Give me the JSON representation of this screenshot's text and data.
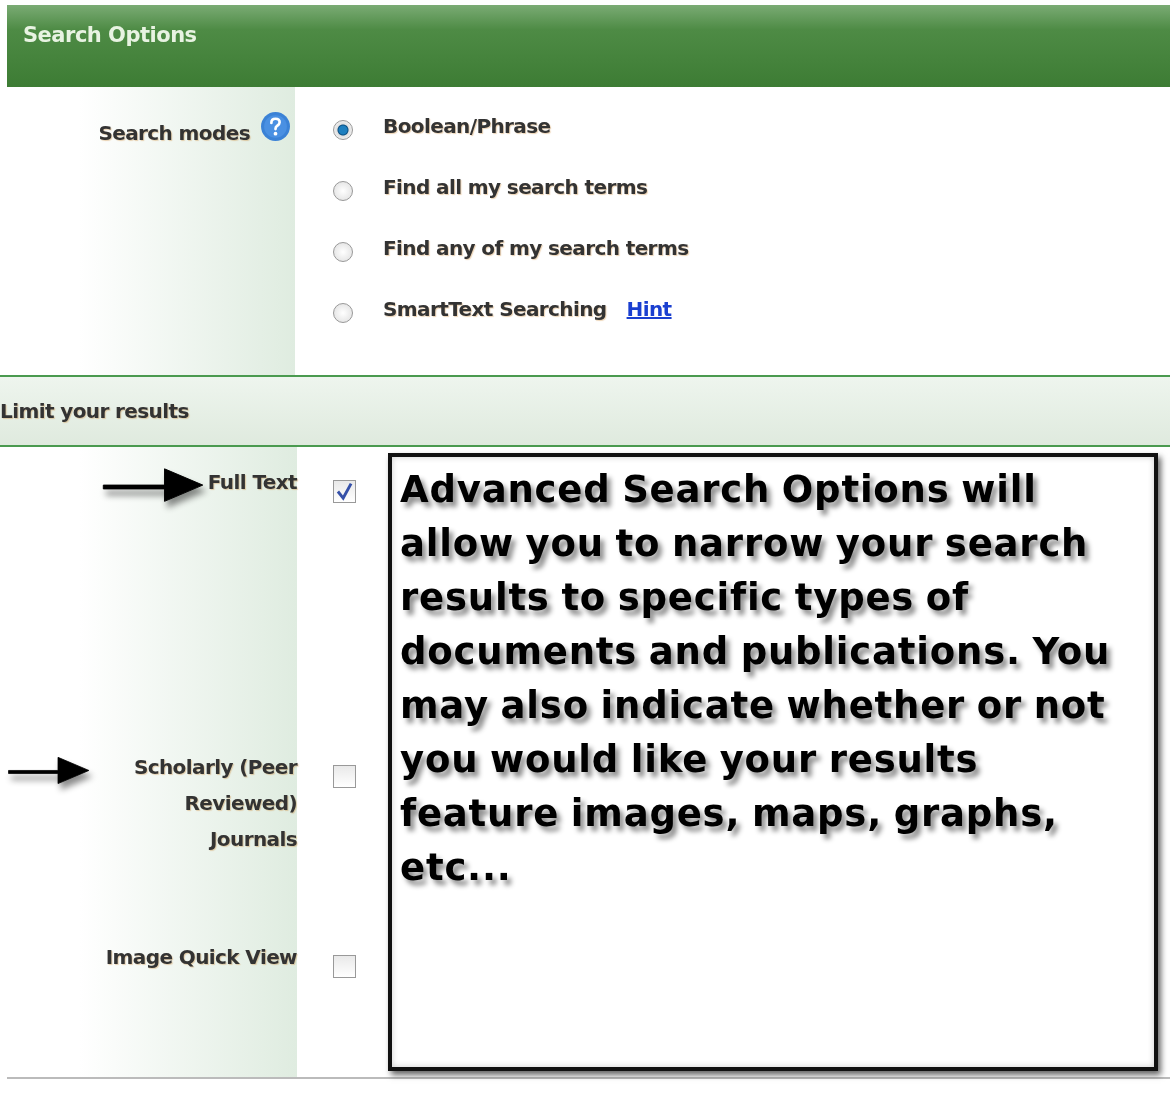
{
  "header": {
    "title": "Search Options"
  },
  "search_modes": {
    "label": "Search modes",
    "options": [
      {
        "label": "Boolean/Phrase",
        "selected": true
      },
      {
        "label": "Find all my search terms",
        "selected": false
      },
      {
        "label": "Find any of my search terms",
        "selected": false
      },
      {
        "label": "SmartText Searching",
        "selected": false,
        "link": "Hint"
      }
    ]
  },
  "limit_section": {
    "title": "Limit your results"
  },
  "limiters": [
    {
      "label": "Full Text",
      "checked": true,
      "marked": true
    },
    {
      "label": "Scholarly (Peer Reviewed) Journals",
      "checked": false,
      "marked": true
    },
    {
      "label": "Image Quick View",
      "checked": false,
      "marked": false
    }
  ],
  "callout": {
    "text": "Advanced Search Options will allow you to narrow your search results to specific types of documents and publications. You may also indicate whether or not you would like your results feature images, maps, graphs, etc..."
  }
}
